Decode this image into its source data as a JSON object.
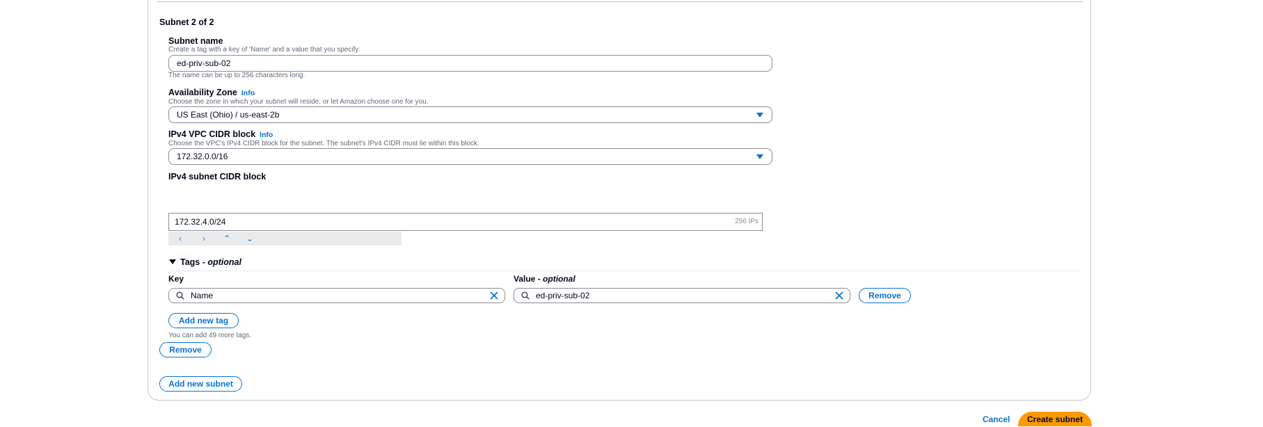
{
  "section": {
    "title": "Subnet 2 of 2"
  },
  "subnet_name": {
    "label": "Subnet name",
    "description": "Create a tag with a key of 'Name' and a value that you specify.",
    "value": "ed-priv-sub-02",
    "constraint": "The name can be up to 256 characters long."
  },
  "availability_zone": {
    "label": "Availability Zone",
    "info": "Info",
    "description": "Choose the zone in which your subnet will reside, or let Amazon choose one for you.",
    "selected": "US East (Ohio) / us-east-2b"
  },
  "vpc_cidr": {
    "label": "IPv4 VPC CIDR block",
    "info": "Info",
    "description": "Choose the VPC's IPv4 CIDR block for the subnet. The subnet's IPv4 CIDR must lie within this block.",
    "selected": "172.32.0.0/16"
  },
  "subnet_cidr": {
    "label": "IPv4 subnet CIDR block",
    "value": "172.32.4.0/24",
    "ip_count": "256 IPs",
    "stepper": [
      "‹",
      "›",
      "⌃",
      "⌄"
    ]
  },
  "tags": {
    "toggle_label": "Tags - ",
    "toggle_optional": "optional",
    "key_label": "Key",
    "value_label": "Value - ",
    "value_optional": "optional",
    "key": "Name",
    "value": "ed-priv-sub-02",
    "remove_label": "Remove",
    "add_label": "Add new tag",
    "limit_text": "You can add 49 more tags."
  },
  "subnet_actions": {
    "remove_label": "Remove",
    "add_subnet_label": "Add new subnet"
  },
  "footer": {
    "cancel_label": "Cancel",
    "create_label": "Create subnet"
  },
  "colors": {
    "accent": "#0972d3",
    "primary": "#ff9900",
    "border": "#8c8c94"
  }
}
